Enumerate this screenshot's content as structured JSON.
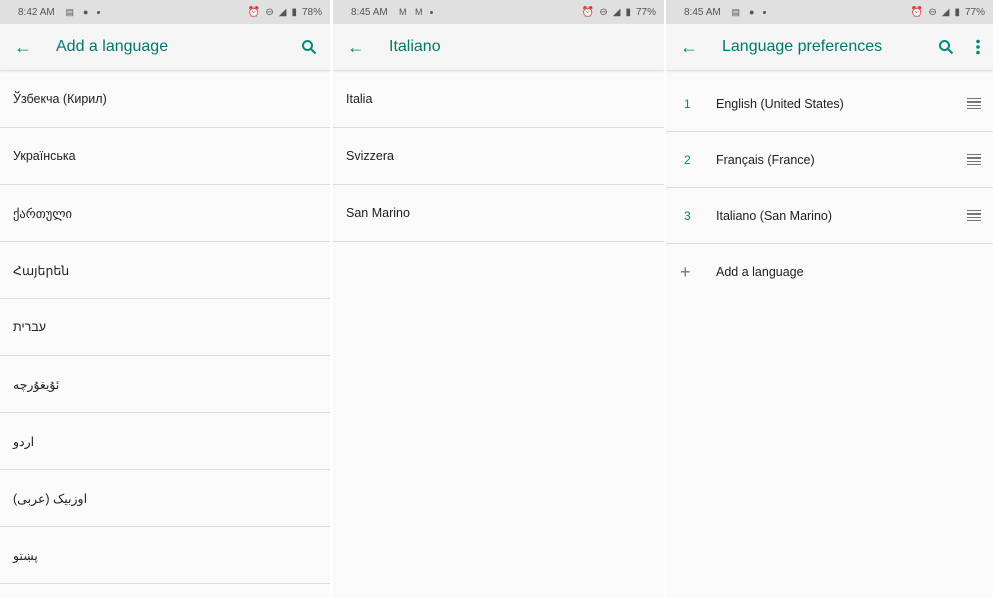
{
  "panels": [
    {
      "status": {
        "time": "8:42 AM",
        "notif_icons": [
          "news-icon",
          "messenger-icon"
        ],
        "battery": "78%"
      },
      "title": "Add a language",
      "actions": [
        "search"
      ],
      "items": [
        "Ўзбекча (Кирил)",
        "Українська",
        "ქართული",
        "Հայերեն",
        "עברית",
        "ئۇيغۇرچە",
        "اردو",
        "اوزبیک (عربی)",
        "پښتو"
      ]
    },
    {
      "status": {
        "time": "8:45 AM",
        "notif_icons": [
          "gmail-icon",
          "gmail-icon"
        ],
        "battery": "77%"
      },
      "title": "Italiano",
      "items": [
        "Italia",
        "Svizzera",
        "San Marino"
      ]
    },
    {
      "status": {
        "time": "8:45 AM",
        "notif_icons": [
          "news-icon",
          "messenger-icon"
        ],
        "battery": "77%"
      },
      "title": "Language preferences",
      "actions": [
        "search",
        "more"
      ],
      "preferences": [
        {
          "rank": "1",
          "label": "English (United States)"
        },
        {
          "rank": "2",
          "label": "Français (France)"
        },
        {
          "rank": "3",
          "label": "Italiano (San Marino)"
        }
      ],
      "add_label": "Add a language"
    }
  ],
  "colors": {
    "accent": "#00897b",
    "title": "#00796b"
  }
}
